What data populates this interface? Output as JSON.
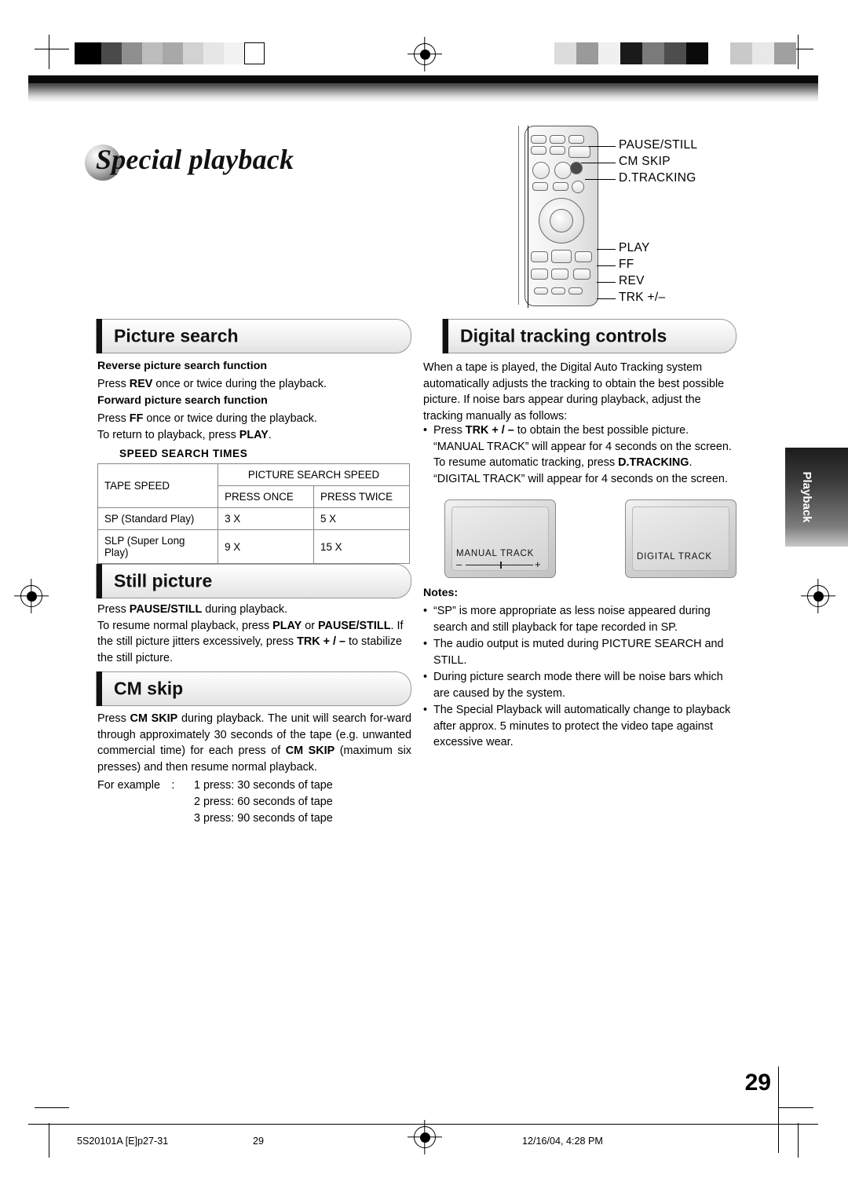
{
  "document": {
    "title": "Special playback",
    "page_number": "29",
    "side_tab": "Playback"
  },
  "remote": {
    "callouts": [
      "PAUSE/STILL",
      "CM SKIP",
      "D.TRACKING",
      "PLAY",
      "FF",
      "REV",
      "TRK +/–"
    ]
  },
  "sections": {
    "picture_search": {
      "heading": "Picture search",
      "reverse_head": "Reverse picture search function",
      "reverse_body": "Press REV once or twice during the playback.",
      "reverse_body_parts": {
        "pre": "Press ",
        "bold": "REV",
        "post": " once or twice during the playback."
      },
      "forward_head": "Forward picture search function",
      "forward_body_parts": {
        "pre": "Press ",
        "bold": "FF",
        "post": " once or twice during the playback."
      },
      "forward_body_line2_parts": {
        "pre": "To return to playback, press ",
        "bold": "PLAY",
        "post": "."
      },
      "table_title": "SPEED SEARCH TIMES",
      "table": {
        "col_tape_speed": "TAPE SPEED",
        "col_group": "PICTURE SEARCH SPEED",
        "col_once": "PRESS ONCE",
        "col_twice": "PRESS TWICE",
        "rows": [
          {
            "speed": "SP (Standard Play)",
            "once": "3 X",
            "twice": "5 X"
          },
          {
            "speed": "SLP (Super Long Play)",
            "once": "9 X",
            "twice": "15 X"
          }
        ]
      }
    },
    "still_picture": {
      "heading": "Still picture",
      "line1": {
        "pre": "Press ",
        "bold": "PAUSE/STILL",
        "post": " during playback."
      },
      "line2": {
        "pre": "To resume normal playback, press ",
        "bold1": "PLAY",
        "mid": " or ",
        "bold2": "PAUSE/STILL",
        "post": "."
      },
      "line3": {
        "pre": "If the still picture jitters excessively, press ",
        "bold": "TRK + / –",
        "post": " to stabilize the still picture."
      }
    },
    "cm_skip": {
      "heading": "CM skip",
      "para": {
        "p1": "Press ",
        "b1": "CM SKIP",
        "p2": " during playback. The unit will search for-ward through approximately 30 seconds of the tape (e.g. unwanted commercial time) for each press of ",
        "b2": "CM SKIP",
        "p3": " (maximum six presses) and then resume normal playback."
      },
      "example_label": "For example :",
      "examples": [
        "1 press: 30 seconds of tape",
        "2 press: 60 seconds of tape",
        "3 press: 90 seconds of tape"
      ]
    },
    "digital_tracking": {
      "heading": "Digital tracking controls",
      "intro": "When a tape is played, the Digital Auto Tracking system automatically adjusts the tracking to obtain the best possible picture. If noise bars appear during playback, adjust the tracking manually as follows:",
      "bullet": {
        "p1": "Press ",
        "b1": "TRK + / –",
        "p2": " to obtain the best possible picture. “MANUAL TRACK” will appear for 4 seconds on the screen. To resume automatic tracking, press ",
        "b2": "D.TRACKING",
        "p3": ". “DIGITAL TRACK” will appear for 4 seconds on the screen."
      },
      "tv1_label": "MANUAL  TRACK",
      "tv1_minus": "–",
      "tv1_plus": "+",
      "tv2_label": "DIGITAL TRACK",
      "notes_head": "Notes:",
      "notes": [
        "“SP” is more appropriate as less noise appeared during search and still playback for tape recorded in SP.",
        "The audio output is muted during PICTURE SEARCH and STILL.",
        "During picture search mode there will be noise bars which are caused by the system.",
        "The Special Playback will automatically change to playback after approx. 5 minutes to protect the video tape against excessive wear."
      ]
    }
  },
  "footer": {
    "left": "5S20101A [E]p27-31",
    "center": "29",
    "right": "12/16/04, 4:28 PM"
  },
  "colors": {
    "accent_black": "#111111",
    "rule_gray": "#8a8a8a"
  }
}
